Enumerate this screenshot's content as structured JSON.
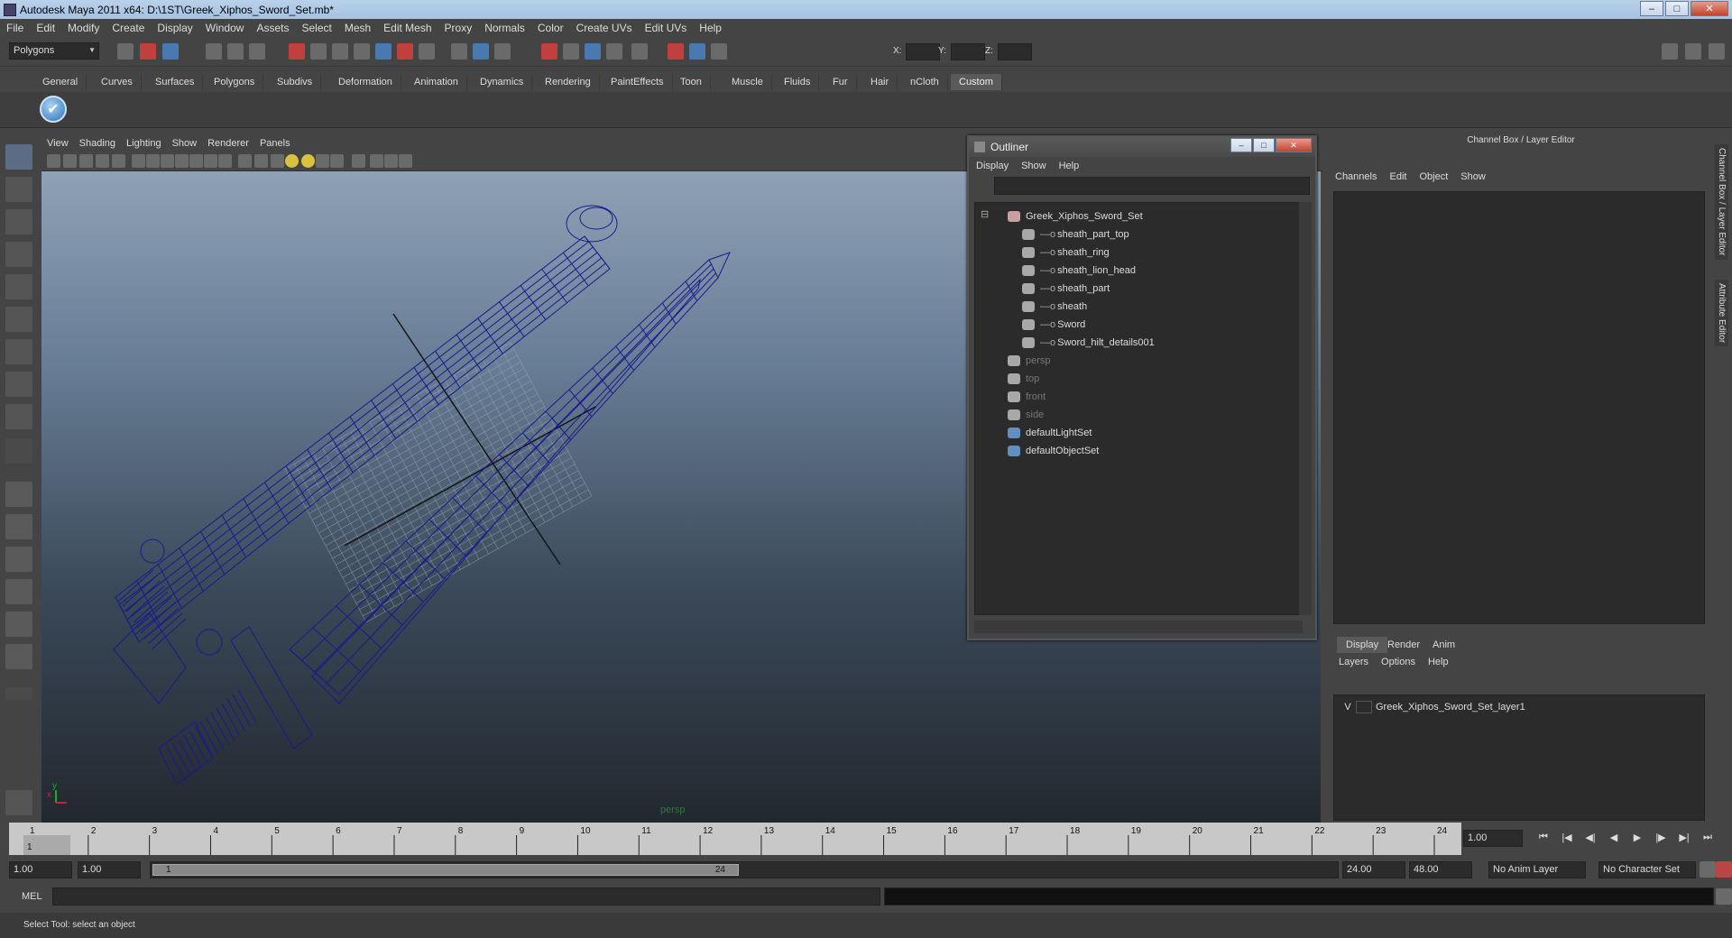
{
  "window": {
    "title": "Autodesk Maya 2011 x64: D:\\1ST\\Greek_Xiphos_Sword_Set.mb*"
  },
  "menubar": [
    "File",
    "Edit",
    "Modify",
    "Create",
    "Display",
    "Window",
    "Assets",
    "Select",
    "Mesh",
    "Edit Mesh",
    "Proxy",
    "Normals",
    "Color",
    "Create UVs",
    "Edit UVs",
    "Help"
  ],
  "toolbar": {
    "mode": "Polygons",
    "x_label": "X:",
    "y_label": "Y:",
    "z_label": "Z:"
  },
  "shelf_tabs": [
    "General",
    "Curves",
    "Surfaces",
    "Polygons",
    "Subdivs",
    "Deformation",
    "Animation",
    "Dynamics",
    "Rendering",
    "PaintEffects",
    "Toon",
    "Muscle",
    "Fluids",
    "Fur",
    "Hair",
    "nCloth",
    "Custom"
  ],
  "shelf_active": "Custom",
  "viewport": {
    "menu": [
      "View",
      "Shading",
      "Lighting",
      "Show",
      "Renderer",
      "Panels"
    ],
    "camera_label": "persp"
  },
  "outliner": {
    "title": "Outliner",
    "menu": [
      "Display",
      "Show",
      "Help"
    ],
    "items": [
      {
        "label": "Greek_Xiphos_Sword_Set",
        "depth": 0,
        "dim": false,
        "type": "group"
      },
      {
        "label": "sheath_part_top",
        "depth": 1,
        "dim": false,
        "type": "mesh"
      },
      {
        "label": "sheath_ring",
        "depth": 1,
        "dim": false,
        "type": "mesh"
      },
      {
        "label": "sheath_lion_head",
        "depth": 1,
        "dim": false,
        "type": "mesh"
      },
      {
        "label": "sheath_part",
        "depth": 1,
        "dim": false,
        "type": "mesh"
      },
      {
        "label": "sheath",
        "depth": 1,
        "dim": false,
        "type": "mesh"
      },
      {
        "label": "Sword",
        "depth": 1,
        "dim": false,
        "type": "mesh"
      },
      {
        "label": "Sword_hilt_details001",
        "depth": 1,
        "dim": false,
        "type": "mesh"
      },
      {
        "label": "persp",
        "depth": 0,
        "dim": true,
        "type": "camera"
      },
      {
        "label": "top",
        "depth": 0,
        "dim": true,
        "type": "camera"
      },
      {
        "label": "front",
        "depth": 0,
        "dim": true,
        "type": "camera"
      },
      {
        "label": "side",
        "depth": 0,
        "dim": true,
        "type": "camera"
      },
      {
        "label": "defaultLightSet",
        "depth": 0,
        "dim": false,
        "type": "set"
      },
      {
        "label": "defaultObjectSet",
        "depth": 0,
        "dim": false,
        "type": "set"
      }
    ]
  },
  "channelbox": {
    "title": "Channel Box / Layer Editor",
    "menu": [
      "Channels",
      "Edit",
      "Object",
      "Show"
    ]
  },
  "side_tabs": [
    "Channel Box / Layer Editor",
    "Attribute Editor"
  ],
  "layer_editor": {
    "tabs": [
      "Display",
      "Render",
      "Anim"
    ],
    "active_tab": "Display",
    "menu": [
      "Layers",
      "Options",
      "Help"
    ],
    "layers": [
      {
        "visible": "V",
        "name": "Greek_Xiphos_Sword_Set_layer1"
      }
    ]
  },
  "timeline": {
    "ticks": [
      1,
      2,
      3,
      4,
      5,
      6,
      7,
      8,
      9,
      10,
      11,
      12,
      13,
      14,
      15,
      16,
      17,
      18,
      19,
      20,
      21,
      22,
      23,
      24
    ],
    "current_frame": "1",
    "current_time_field": "1.00"
  },
  "range": {
    "start_time": "1.00",
    "start_range": "1.00",
    "range_start_label": "1",
    "range_end_label": "24",
    "end_range": "24.00",
    "end_time": "48.00",
    "anim_layer": "No Anim Layer",
    "character_set": "No Character Set"
  },
  "mel": {
    "label": "MEL"
  },
  "status": {
    "help_text": "Select Tool: select an object"
  },
  "colors": {
    "wire": "#1a1a8c",
    "grid": "#9aa8b8"
  }
}
